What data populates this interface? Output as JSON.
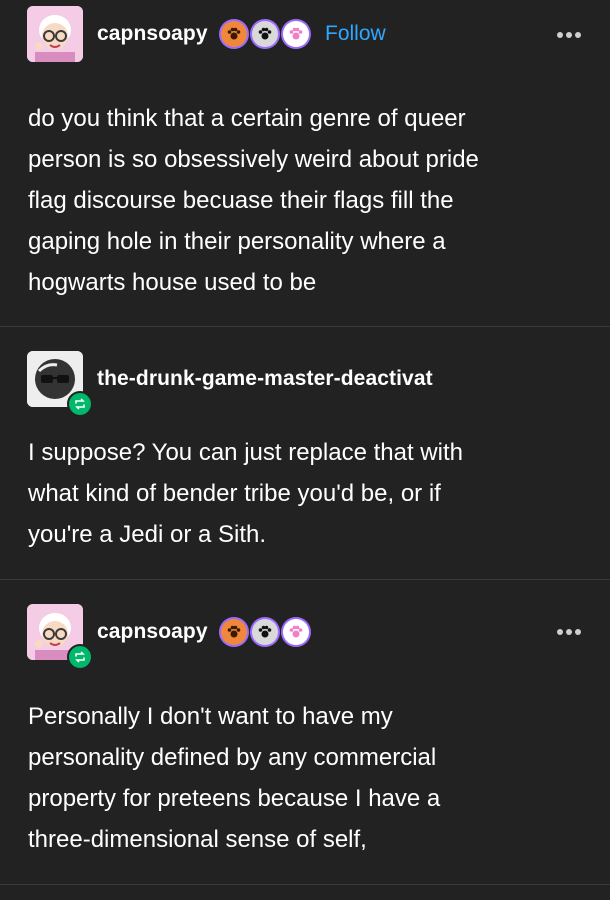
{
  "post1": {
    "username": "capnsoapy",
    "follow_label": "Follow",
    "body": [
      "do you think that a certain genre of queer",
      "person is so obsessively weird about pride",
      "flag discourse becuase their flags fill the",
      "gaping hole in their personality where a",
      "hogwarts house used to be"
    ]
  },
  "reblog1": {
    "username": "the-drunk-game-master-deactivat",
    "body": [
      "I suppose? You can just replace that with",
      "what kind of bender tribe you'd be, or if",
      "you're a Jedi or a Sith."
    ]
  },
  "reblog2": {
    "username": "capnsoapy",
    "body": [
      "Personally I  don't want to have my",
      "personality defined by any commercial",
      "property for preteens because I have a",
      "three-dimensional sense of self,"
    ]
  },
  "icons": {
    "more": "more-options-icon",
    "reblog": "reblog-icon",
    "badge_orange": "paw-badge-icon",
    "badge_gray": "paw-badge-icon",
    "badge_pink": "paw-badge-icon"
  },
  "colors": {
    "background": "#222222",
    "text": "#ffffff",
    "follow": "#2ea8ff",
    "reblog_badge": "#00b86b",
    "badge_orange": "#f0873a",
    "badge_gray": "#d9d9d9",
    "badge_pink": "#f27ec8",
    "badge_ring": "#9b6bff"
  }
}
